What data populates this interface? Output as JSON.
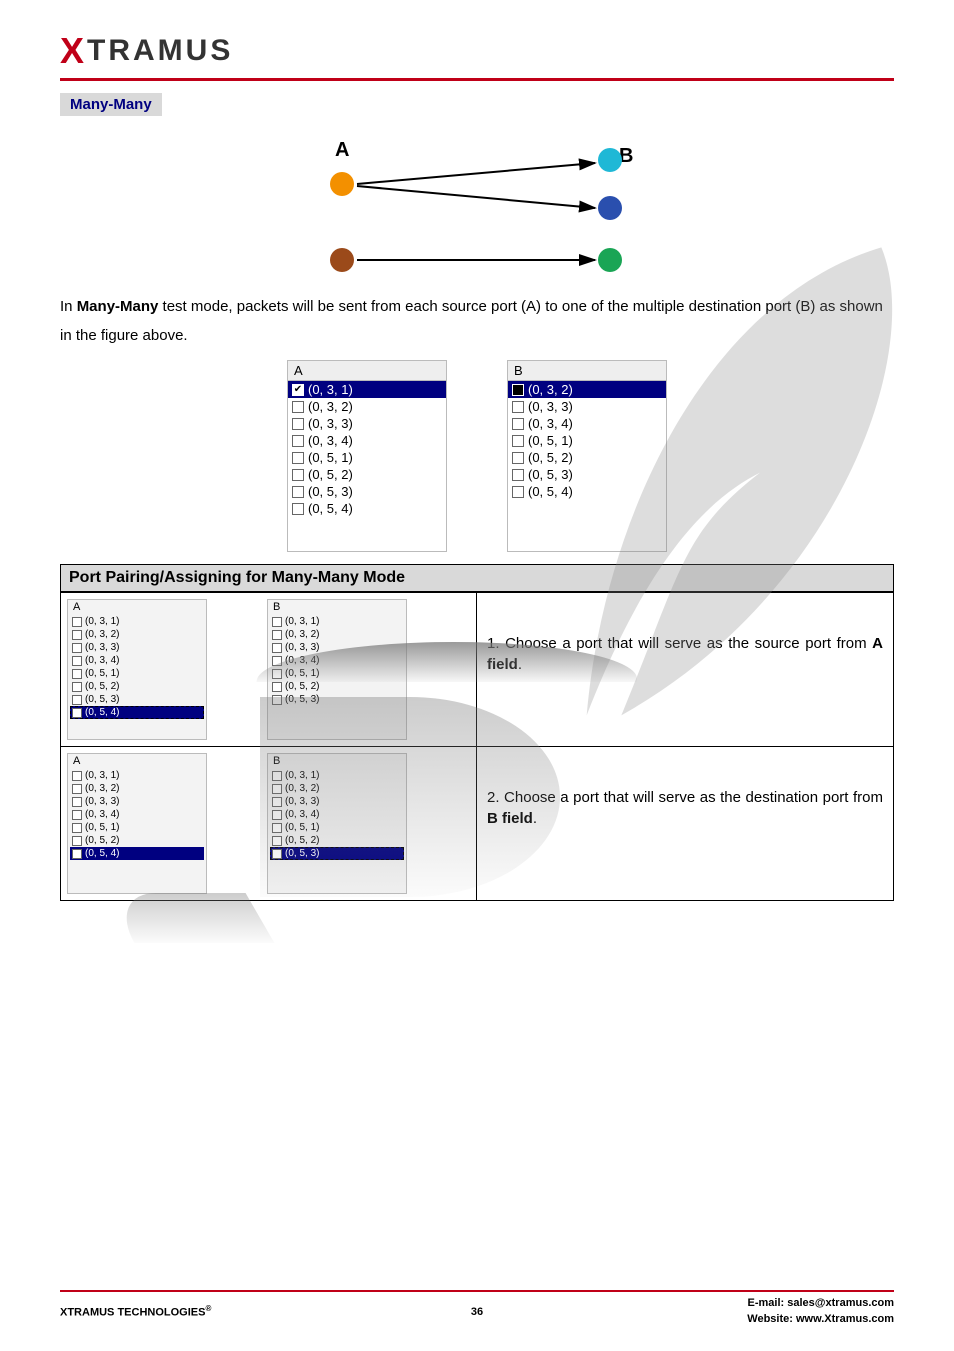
{
  "logo": {
    "x": "X",
    "rest": "TRAMUS"
  },
  "section_title": "Many-Many",
  "diagram": {
    "label_a": "A",
    "label_b": "B"
  },
  "intro_text_pre": "In ",
  "intro_text_bold": "Many-Many",
  "intro_text_post": " test mode, packets will be sent from each source port (A) to one of the multiple destination port (B) as shown in the figure above.",
  "main_ports": {
    "a": {
      "header": "A",
      "items": [
        {
          "label": "(0, 3, 1)",
          "checked": true,
          "selected": true
        },
        {
          "label": "(0, 3, 2)",
          "checked": false
        },
        {
          "label": "(0, 3, 3)",
          "checked": false
        },
        {
          "label": "(0, 3, 4)",
          "checked": false
        },
        {
          "label": "(0, 5, 1)",
          "checked": false
        },
        {
          "label": "(0, 5, 2)",
          "checked": false
        },
        {
          "label": "(0, 5, 3)",
          "checked": false
        },
        {
          "label": "(0, 5, 4)",
          "checked": false
        }
      ]
    },
    "b": {
      "header": "B",
      "items": [
        {
          "label": "(0, 3, 2)",
          "checked": false,
          "selected": true,
          "dark": true
        },
        {
          "label": "(0, 3, 3)",
          "checked": false
        },
        {
          "label": "(0, 3, 4)",
          "checked": false
        },
        {
          "label": "(0, 5, 1)",
          "checked": false
        },
        {
          "label": "(0, 5, 2)",
          "checked": false
        },
        {
          "label": "(0, 5, 3)",
          "checked": false
        },
        {
          "label": "(0, 5, 4)",
          "checked": false
        }
      ]
    }
  },
  "table_header": "Port Pairing/Assigning for Many-Many Mode",
  "steps": [
    {
      "a": {
        "header": "A",
        "items": [
          {
            "label": "(0, 3, 1)"
          },
          {
            "label": "(0, 3, 2)"
          },
          {
            "label": "(0, 3, 3)"
          },
          {
            "label": "(0, 3, 4)"
          },
          {
            "label": "(0, 5, 1)"
          },
          {
            "label": "(0, 5, 2)"
          },
          {
            "label": "(0, 5, 3)"
          },
          {
            "label": "(0, 5, 4)",
            "checked": true,
            "selected": true,
            "dash": true
          }
        ]
      },
      "b": {
        "header": "B",
        "items": [
          {
            "label": "(0, 3, 1)"
          },
          {
            "label": "(0, 3, 2)"
          },
          {
            "label": "(0, 3, 3)"
          },
          {
            "label": "(0, 3, 4)"
          },
          {
            "label": "(0, 5, 1)"
          },
          {
            "label": "(0, 5, 2)"
          },
          {
            "label": "(0, 5, 3)"
          }
        ]
      },
      "desc_prefix": "1. Choose a port that will serve as the source port from ",
      "desc_bold": "A field",
      "desc_suffix": "."
    },
    {
      "a": {
        "header": "A",
        "items": [
          {
            "label": "(0, 3, 1)"
          },
          {
            "label": "(0, 3, 2)"
          },
          {
            "label": "(0, 3, 3)"
          },
          {
            "label": "(0, 3, 4)"
          },
          {
            "label": "(0, 5, 1)"
          },
          {
            "label": "(0, 5, 2)"
          },
          {
            "label": "(0, 5, 4)",
            "checked": true,
            "selected": true
          }
        ]
      },
      "b": {
        "header": "B",
        "items": [
          {
            "label": "(0, 3, 1)"
          },
          {
            "label": "(0, 3, 2)"
          },
          {
            "label": "(0, 3, 3)"
          },
          {
            "label": "(0, 3, 4)"
          },
          {
            "label": "(0, 5, 1)"
          },
          {
            "label": "(0, 5, 2)"
          },
          {
            "label": "(0, 5, 3)",
            "checked": true,
            "selected": true,
            "dash": true
          }
        ]
      },
      "desc_prefix": "2. Choose a port that will serve as the destination port from ",
      "desc_bold": "B field",
      "desc_suffix": "."
    }
  ],
  "footer": {
    "left": "XTRAMUS TECHNOLOGIES",
    "reg": "®",
    "page": "36",
    "email_label": "E-mail: ",
    "email": "sales@xtramus.com",
    "web_label": "Website:  ",
    "web": "www.Xtramus.com"
  }
}
